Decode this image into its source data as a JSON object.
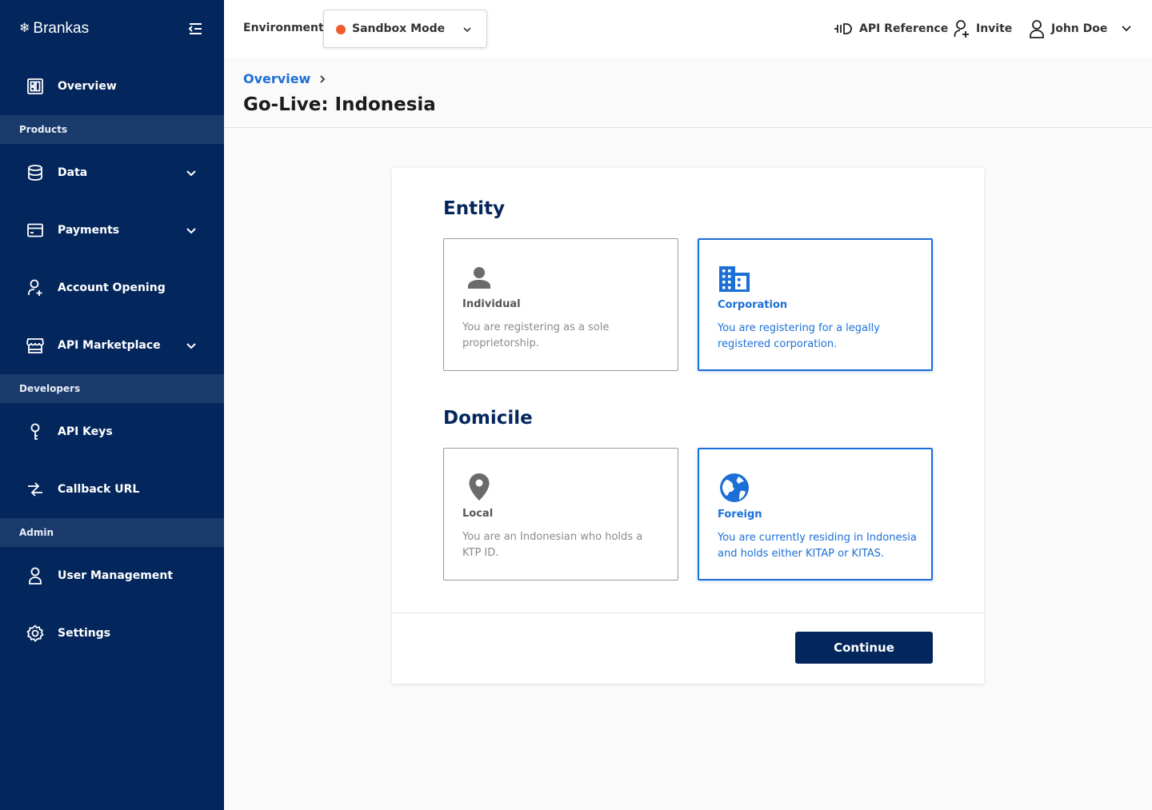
{
  "brand": {
    "name": "Brankas",
    "mark": "❄"
  },
  "sidebar": {
    "items": [
      {
        "label": "Overview"
      },
      {
        "label": "Data"
      },
      {
        "label": "Payments"
      },
      {
        "label": "Account Opening"
      },
      {
        "label": "API Marketplace"
      },
      {
        "label": "API Keys"
      },
      {
        "label": "Callback URL"
      },
      {
        "label": "User Management"
      },
      {
        "label": "Settings"
      }
    ],
    "sections": [
      {
        "label": "Products"
      },
      {
        "label": "Developers"
      },
      {
        "label": "Admin"
      }
    ]
  },
  "topbar": {
    "env_label": "Environment:",
    "env_value": "Sandbox Mode",
    "env_color": "#f05a2a",
    "api_reference": "API Reference",
    "invite": "Invite",
    "user": "John Doe"
  },
  "header": {
    "breadcrumb": "Overview",
    "title": "Go-Live: Indonesia"
  },
  "form": {
    "entity": {
      "title": "Entity",
      "options": [
        {
          "title": "Individual",
          "desc": "You are registering as a sole proprietorship.",
          "selected": false,
          "icon": "person-icon"
        },
        {
          "title": "Corporation",
          "desc": "You are registering for a legally registered corporation.",
          "selected": true,
          "icon": "building-icon"
        }
      ]
    },
    "domicile": {
      "title": "Domicile",
      "options": [
        {
          "title": "Local",
          "desc": "You are an Indonesian who holds a KTP ID.",
          "selected": false,
          "icon": "location-pin-icon"
        },
        {
          "title": "Foreign",
          "desc": "You are currently residing in Indonesia and holds either KITAP or KITAS.",
          "selected": true,
          "icon": "globe-icon"
        }
      ]
    },
    "continue_label": "Continue"
  },
  "colors": {
    "sidebar_bg": "#03265c",
    "section_bg": "#1b3a6c",
    "accent": "#1b6fd6",
    "primary_button": "#03265c"
  }
}
